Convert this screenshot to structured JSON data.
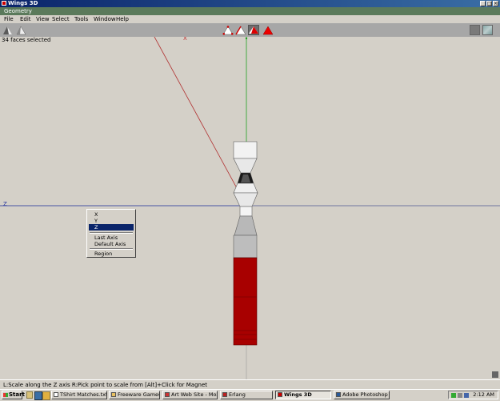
{
  "window": {
    "title": "Wings 3D",
    "controls": [
      "_",
      "□",
      "×"
    ]
  },
  "geometry_tab": {
    "label": "Geometry"
  },
  "menu": [
    "File",
    "Edit",
    "View",
    "Select",
    "Tools",
    "Window",
    "Help"
  ],
  "toolbar": {
    "selection_modes": [
      "vertex-mode",
      "edge-mode",
      "face-mode",
      "body-mode"
    ],
    "active_mode": "face-mode"
  },
  "viewport": {
    "info_text": "34 faces selected",
    "axis_label_z": "Z",
    "axis_label_x": "X"
  },
  "context_menu": {
    "items": [
      {
        "label": "X"
      },
      {
        "label": "Y"
      },
      {
        "label": "Z"
      },
      {
        "label": "Last Axis"
      },
      {
        "label": "Default Axis"
      },
      {
        "label": "Region"
      }
    ],
    "selected": "Z"
  },
  "status": {
    "text": "L:Scale along the Z axis   R:Pick point to scale from   [Alt]+Click for Magnet"
  },
  "taskbar": {
    "start_label": "Start",
    "tasks": [
      {
        "label": "TShirt Matches.txt - ..."
      },
      {
        "label": "Freeware Games"
      },
      {
        "label": "Art Web Site - Mozilla"
      },
      {
        "label": "Erlang"
      },
      {
        "label": "Wings 3D"
      },
      {
        "label": "Adobe Photoshop"
      }
    ],
    "active_task": "Wings 3D",
    "clock": "2:12 AM"
  },
  "colors": {
    "titlebar": "#0a246a",
    "geometry_tab": "#5b7a5b",
    "viewport_bg": "#d4d0c8",
    "selected_face": "#a80000",
    "axis_x": "#c03030",
    "axis_y": "#20a020",
    "axis_z": "#1b2a9a"
  }
}
